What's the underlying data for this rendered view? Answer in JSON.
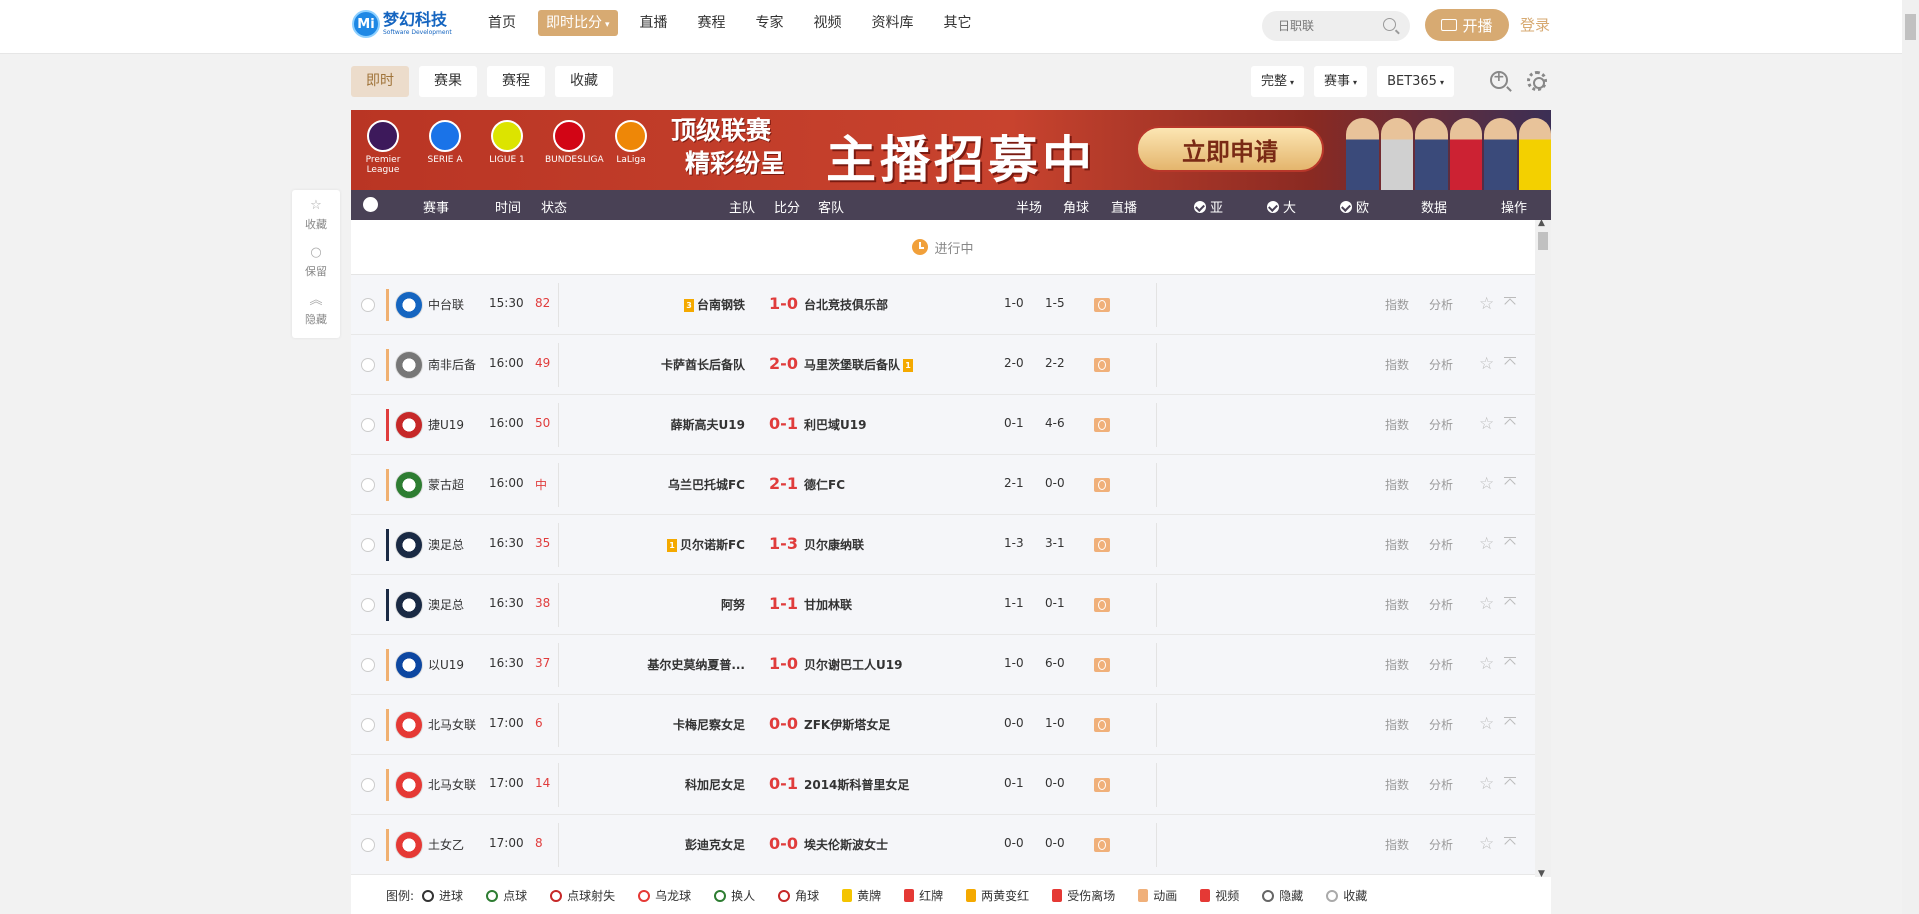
{
  "brand": {
    "logo_letters": "Mi",
    "name": "梦幻科技",
    "sub": "Software Development"
  },
  "nav": [
    "首页",
    "即时比分",
    "直播",
    "赛程",
    "专家",
    "视频",
    "资料库",
    "其它"
  ],
  "nav_active": 1,
  "search": {
    "placeholder": "日职联"
  },
  "live_button": "开播",
  "login": "登录",
  "subtabs": [
    "即时",
    "赛果",
    "赛程",
    "收藏"
  ],
  "filters": [
    "完整",
    "赛事",
    "BET365"
  ],
  "banner": {
    "leagues": [
      "Premier League",
      "SERIE A",
      "LIGUE 1",
      "BUNDESLIGA",
      "LaLiga"
    ],
    "slogan_line1": "顶级联赛",
    "slogan_line2": "精彩纷呈",
    "headline": "主播招募中",
    "apply": "立即申请"
  },
  "table_header": {
    "league": "赛事",
    "time": "时间",
    "status": "状态",
    "home": "主队",
    "score": "比分",
    "away": "客队",
    "half": "半场",
    "corner": "角球",
    "live": "直播",
    "ya": "亚",
    "da": "大",
    "ou": "欧",
    "data": "数据",
    "ops": "操作"
  },
  "section_label": "进行中",
  "row_actions": {
    "index": "指数",
    "analysis": "分析"
  },
  "matches": [
    {
      "league": "中台联",
      "color": "#f0b070",
      "time": "15:30",
      "minute": "82",
      "home": "台南钢铁",
      "home_card": "3",
      "score": "1-0",
      "away": "台北竞技俱乐部",
      "away_card": "",
      "half": "1-0",
      "corner": "1-5"
    },
    {
      "league": "南非后备",
      "color": "#f0b070",
      "time": "16:00",
      "minute": "49",
      "home": "卡萨酋长后备队",
      "home_card": "",
      "score": "2-0",
      "away": "马里茨堡联后备队",
      "away_card": "1",
      "half": "2-0",
      "corner": "2-2"
    },
    {
      "league": "捷U19",
      "color": "#e03c3c",
      "time": "16:00",
      "minute": "50",
      "home": "薛斯高夫U19",
      "home_card": "",
      "score": "0-1",
      "away": "利巴域U19",
      "away_card": "",
      "half": "0-1",
      "corner": "4-6"
    },
    {
      "league": "蒙古超",
      "color": "#f0b070",
      "time": "16:00",
      "minute": "中",
      "home": "乌兰巴托城FC",
      "home_card": "",
      "score": "2-1",
      "away": "德仁FC",
      "away_card": "",
      "half": "2-1",
      "corner": "0-0"
    },
    {
      "league": "澳足总",
      "color": "#1a2a44",
      "time": "16:30",
      "minute": "35",
      "home": "贝尔诺斯FC",
      "home_card": "1",
      "score": "1-3",
      "away": "贝尔康纳联",
      "away_card": "",
      "half": "1-3",
      "corner": "3-1"
    },
    {
      "league": "澳足总",
      "color": "#1a2a44",
      "time": "16:30",
      "minute": "38",
      "home": "阿努",
      "home_card": "",
      "score": "1-1",
      "away": "甘加林联",
      "away_card": "",
      "half": "1-1",
      "corner": "0-1"
    },
    {
      "league": "以U19",
      "color": "#f0b070",
      "time": "16:30",
      "minute": "37",
      "home": "基尔史莫纳夏普...",
      "home_card": "",
      "score": "1-0",
      "away": "贝尔谢巴工人U19",
      "away_card": "",
      "half": "1-0",
      "corner": "6-0"
    },
    {
      "league": "北马女联",
      "color": "#f0b070",
      "time": "17:00",
      "minute": "6",
      "home": "卡梅尼察女足",
      "home_card": "",
      "score": "0-0",
      "away": "ZFK伊斯塔女足",
      "away_card": "",
      "half": "0-0",
      "corner": "1-0"
    },
    {
      "league": "北马女联",
      "color": "#f0b070",
      "time": "17:00",
      "minute": "14",
      "home": "科加尼女足",
      "home_card": "",
      "score": "0-1",
      "away": "2014斯科普里女足",
      "away_card": "",
      "half": "0-1",
      "corner": "0-0"
    },
    {
      "league": "土女乙",
      "color": "#f0b070",
      "time": "17:00",
      "minute": "8",
      "home": "彭迪克女足",
      "home_card": "",
      "score": "0-0",
      "away": "埃夫伦斯波女士",
      "away_card": "",
      "half": "0-0",
      "corner": "0-0"
    }
  ],
  "side_panel": [
    "收藏",
    "保留",
    "隐藏"
  ],
  "legend": {
    "label": "图例:",
    "items": [
      "进球",
      "点球",
      "点球射失",
      "乌龙球",
      "换人",
      "角球",
      "黄牌",
      "红牌",
      "两黄变红",
      "受伤离场",
      "动画",
      "视频",
      "隐藏",
      "收藏"
    ]
  }
}
